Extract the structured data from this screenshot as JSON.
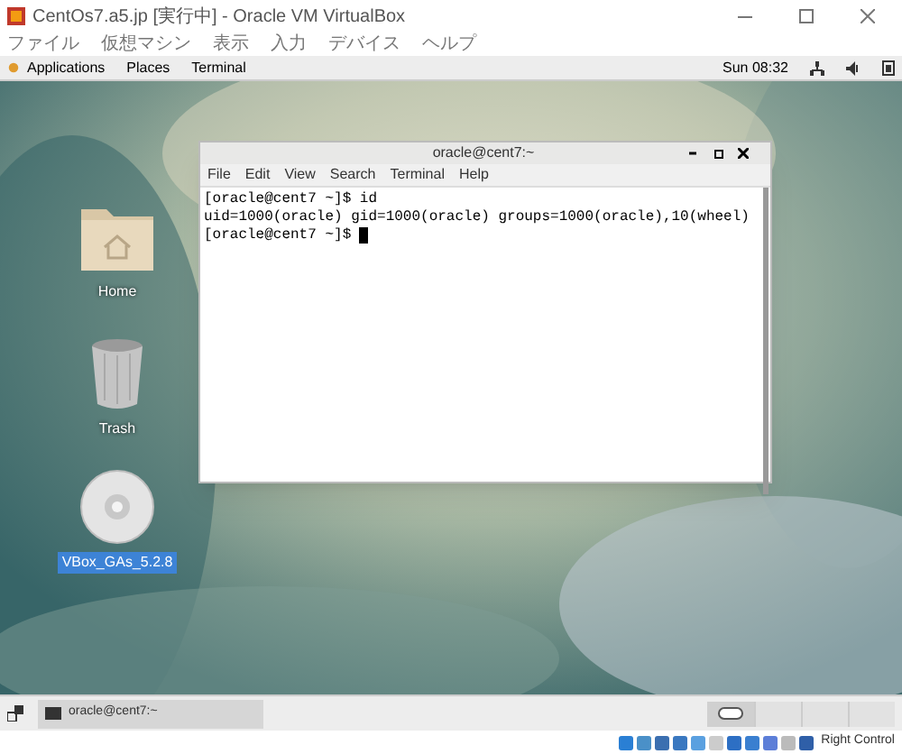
{
  "window": {
    "title": "CentOs7.a5.jp [実行中] - Oracle VM VirtualBox",
    "menu": [
      "ファイル",
      "仮想マシン",
      "表示",
      "入力",
      "デバイス",
      "ヘルプ"
    ]
  },
  "top_bar": {
    "menus": [
      "Applications",
      "Places",
      "Terminal"
    ],
    "clock": "Sun 08:32"
  },
  "desktop_icons": [
    {
      "label": "Home",
      "kind": "folder",
      "selected": false
    },
    {
      "label": "Trash",
      "kind": "trash",
      "selected": false
    },
    {
      "label": "VBox_GAs_5.2.8",
      "kind": "disc",
      "selected": true
    }
  ],
  "terminal": {
    "title": "oracle@cent7:~",
    "menu": [
      "File",
      "Edit",
      "View",
      "Search",
      "Terminal",
      "Help"
    ],
    "lines": [
      "[oracle@cent7 ~]$ id",
      "uid=1000(oracle) gid=1000(oracle) groups=1000(oracle),10(wheel)",
      "[oracle@cent7 ~]$ "
    ]
  },
  "window_list": [
    {
      "label": "oracle@cent7:~"
    }
  ],
  "status_bar": {
    "host_key": "Right Control"
  }
}
